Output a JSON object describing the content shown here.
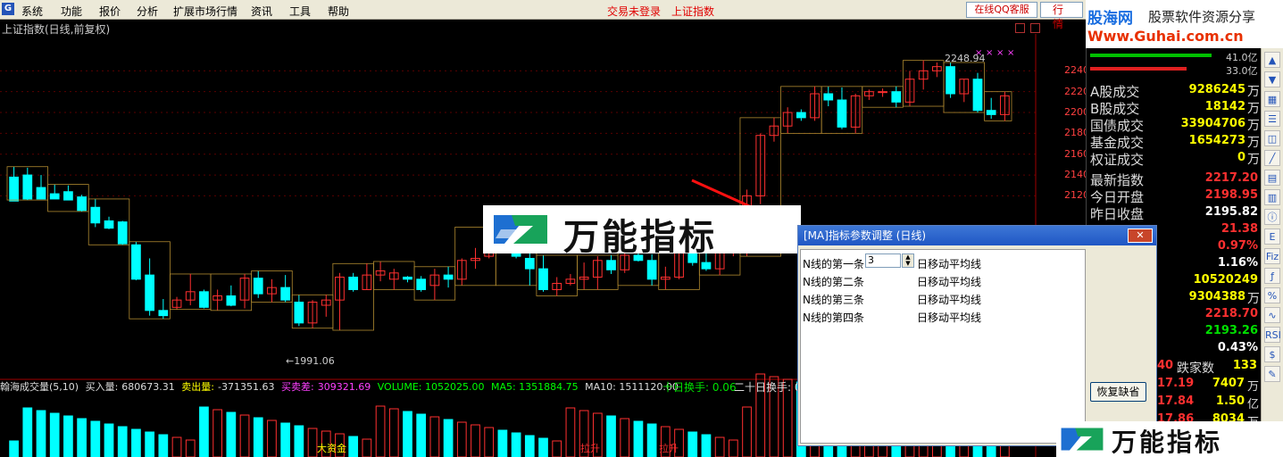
{
  "menubar": {
    "items": [
      "系统",
      "功能",
      "报价",
      "分析",
      "扩展市场行情",
      "资讯",
      "工具",
      "帮助"
    ],
    "status_login": "交易未登录",
    "status_index": "上证指数",
    "qq_button": "在线QQ客服",
    "quote_button": "行 情"
  },
  "brand": {
    "title": "股海网",
    "subtitle": "股票软件资源分享",
    "url": "Www.Guhai.com.cn"
  },
  "chart": {
    "title": "上证指数(日线,前复权)",
    "price_ticks": [
      "2240",
      "2220",
      "2200",
      "2180",
      "2160",
      "2140",
      "2120"
    ],
    "high_label": "2248.94",
    "low_label": "1991.06",
    "accent_up": "#ff3030",
    "accent_down": "#00ffff",
    "candle_data": [
      [
        2138,
        2148,
        2116,
        2115
      ],
      [
        2140,
        2147,
        2116,
        2117
      ],
      [
        2128,
        2140,
        2124,
        2117
      ],
      [
        2122,
        2131,
        2119,
        2117
      ],
      [
        2124,
        2130,
        2118,
        2116
      ],
      [
        2119,
        2121,
        2105,
        2106
      ],
      [
        2109,
        2117,
        2090,
        2094
      ],
      [
        2096,
        2100,
        2088,
        2089
      ],
      [
        2095,
        2096,
        2073,
        2074
      ],
      [
        2073,
        2076,
        2039,
        2040
      ],
      [
        2044,
        2060,
        2005,
        2010
      ],
      [
        2010,
        2021,
        2002,
        2005
      ],
      [
        2013,
        2023,
        2011,
        2020
      ],
      [
        2020,
        2045,
        2015,
        2028
      ],
      [
        2028,
        2030,
        2012,
        2013
      ],
      [
        2020,
        2030,
        2010,
        2024
      ],
      [
        2024,
        2034,
        2014,
        2015
      ],
      [
        2020,
        2045,
        2012,
        2041
      ],
      [
        2041,
        2048,
        2022,
        2026
      ],
      [
        2026,
        2040,
        2018,
        2032
      ],
      [
        2032,
        2044,
        2018,
        2020
      ],
      [
        2018,
        2025,
        1995,
        1998
      ],
      [
        1998,
        2020,
        1993,
        2018
      ],
      [
        2015,
        2025,
        2004,
        2020
      ],
      [
        2020,
        2046,
        1991,
        2042
      ],
      [
        2042,
        2046,
        2028,
        2030
      ],
      [
        2030,
        2055,
        2030,
        2044
      ],
      [
        2044,
        2057,
        2038,
        2048
      ],
      [
        2040,
        2050,
        2030,
        2046
      ],
      [
        2042,
        2043,
        2037,
        2040
      ],
      [
        2040,
        2043,
        2028,
        2030
      ],
      [
        2034,
        2050,
        2020,
        2044
      ],
      [
        2044,
        2052,
        2032,
        2040
      ],
      [
        2040,
        2060,
        2034,
        2058
      ],
      [
        2058,
        2070,
        2050,
        2060
      ],
      [
        2062,
        2090,
        2060,
        2087
      ],
      [
        2087,
        2100,
        2075,
        2080
      ],
      [
        2080,
        2092,
        2060,
        2062
      ],
      [
        2060,
        2075,
        2034,
        2050
      ],
      [
        2050,
        2063,
        2028,
        2030
      ],
      [
        2030,
        2042,
        2024,
        2036
      ],
      [
        2036,
        2045,
        2034,
        2040
      ],
      [
        2040,
        2056,
        2030,
        2042
      ],
      [
        2042,
        2062,
        2030,
        2058
      ],
      [
        2058,
        2063,
        2045,
        2049
      ],
      [
        2049,
        2066,
        2046,
        2063
      ],
      [
        2063,
        2070,
        2057,
        2058
      ],
      [
        2058,
        2064,
        2034,
        2040
      ],
      [
        2040,
        2052,
        2030,
        2042
      ],
      [
        2042,
        2074,
        2040,
        2070
      ],
      [
        2070,
        2080,
        2053,
        2056
      ],
      [
        2056,
        2066,
        2048,
        2050
      ],
      [
        2050,
        2076,
        2044,
        2072
      ],
      [
        2072,
        2082,
        2062,
        2076
      ],
      [
        2076,
        2126,
        2062,
        2120
      ],
      [
        2120,
        2180,
        2112,
        2178
      ],
      [
        2178,
        2195,
        2172,
        2187
      ],
      [
        2187,
        2205,
        2180,
        2200
      ],
      [
        2200,
        2203,
        2192,
        2195
      ],
      [
        2195,
        2225,
        2192,
        2218
      ],
      [
        2218,
        2225,
        2206,
        2212
      ],
      [
        2212,
        2224,
        2184,
        2186
      ],
      [
        2186,
        2218,
        2180,
        2216
      ],
      [
        2216,
        2222,
        2212,
        2220
      ],
      [
        2220,
        2223,
        2215,
        2220
      ],
      [
        2220,
        2225,
        2205,
        2210
      ],
      [
        2210,
        2240,
        2206,
        2232
      ],
      [
        2232,
        2250,
        2222,
        2240
      ],
      [
        2240,
        2248,
        2234,
        2244
      ],
      [
        2244,
        2248,
        2214,
        2218
      ],
      [
        2218,
        2232,
        2210,
        2232
      ],
      [
        2232,
        2238,
        2200,
        2202
      ],
      [
        2202,
        2214,
        2194,
        2198
      ],
      [
        2198,
        2220,
        2192,
        2216
      ]
    ]
  },
  "volume": {
    "title": "翰海成交量(5,10)",
    "buy_label": "买入量:",
    "buy_value": "680673.31",
    "sell_label": "卖出量:",
    "sell_value": "-371351.63",
    "diff_label": "买卖差:",
    "diff_value": "309321.69",
    "volume_label": "VOLUME: 1052025.00",
    "ma5_label": "MA5: 1351884.75",
    "ma10_label": "MA10: 1511120.00",
    "turn10": "十日换手: 0.06",
    "turn20": "二十日换手: 0",
    "marker1": "大资金",
    "marker2": "拉升",
    "marker3": "拉升"
  },
  "right_panel": {
    "bar_caption_1": "41.0亿",
    "bar_caption_2": "33.0亿",
    "stat_rows": [
      {
        "label": "A股成交",
        "value": "9286245",
        "unit": "万",
        "color": "#ffff00"
      },
      {
        "label": "B股成交",
        "value": "18142",
        "unit": "万",
        "color": "#ffff00"
      },
      {
        "label": "国债成交",
        "value": "33904706",
        "unit": "万",
        "color": "#ffff00"
      },
      {
        "label": "基金成交",
        "value": "1654273",
        "unit": "万",
        "color": "#ffff00"
      },
      {
        "label": "权证成交",
        "value": "0",
        "unit": "万",
        "color": "#ffff00"
      }
    ],
    "index_rows": [
      {
        "label": "最新指数",
        "value": "2217.20",
        "color": "#ff3030"
      },
      {
        "label": "今日开盘",
        "value": "2198.95",
        "color": "#ff3030"
      },
      {
        "label": "昨日收盘",
        "value": "2195.82",
        "color": "#ffffff"
      }
    ],
    "values_right": [
      {
        "value": "21.38",
        "color": "#ff3030"
      },
      {
        "value": "0.97%",
        "color": "#ff3030"
      },
      {
        "value": "1.16%",
        "color": "#ffffff"
      },
      {
        "value": "10520249",
        "color": "#ffff00"
      },
      {
        "value": "9304388",
        "color": "#ffff00",
        "unit": "万"
      },
      {
        "value": "2218.70",
        "color": "#ff3030"
      },
      {
        "value": "2193.26",
        "color": "#00e000"
      },
      {
        "value": "0.43%",
        "color": "#ffffff"
      }
    ],
    "bottom_rows": [
      {
        "left": "40",
        "label": "跌家数",
        "value": "133"
      },
      {
        "left": "17.19",
        "value": "7407",
        "unit": "万"
      },
      {
        "left": "17.84",
        "value": "1.50",
        "unit": "亿"
      },
      {
        "left": "17.86",
        "value": "8034",
        "unit": "万"
      }
    ]
  },
  "toolbar": {
    "icons": [
      "up-arrow-icon",
      "down-arrow-icon",
      "grid-icon",
      "list-icon",
      "chart-icon",
      "line-icon",
      "table-icon",
      "bar-icon",
      "info-icon",
      "export-icon",
      "fiz-icon",
      "fx-icon",
      "stats-icon",
      "wave-icon",
      "rsi-icon",
      "dollar-icon",
      "pencil-icon"
    ],
    "labels": [
      "▲",
      "▼",
      "▦",
      "☰",
      "◫",
      "╱",
      "▤",
      "▥",
      "ⓘ",
      "E",
      "Fiz",
      "ƒ",
      "%",
      "∿",
      "RSI",
      "$",
      "✎"
    ]
  },
  "banner": {
    "text": "万能指标"
  },
  "dialog": {
    "title": "[MA]指标参数调整 (日线)",
    "close": "✕",
    "params": [
      {
        "label": "N线的第一条",
        "value": "3",
        "unit": "日移动平均线",
        "has_input": true
      },
      {
        "label": "N线的第二条",
        "value": "",
        "unit": "日移动平均线",
        "has_input": false
      },
      {
        "label": "N线的第三条",
        "value": "",
        "unit": "日移动平均线",
        "has_input": false
      },
      {
        "label": "N线的第四条",
        "value": "",
        "unit": "日移动平均线",
        "has_input": false
      }
    ],
    "restore_button": "恢复缺省"
  },
  "bottom_logo": {
    "text": "万能指标"
  }
}
